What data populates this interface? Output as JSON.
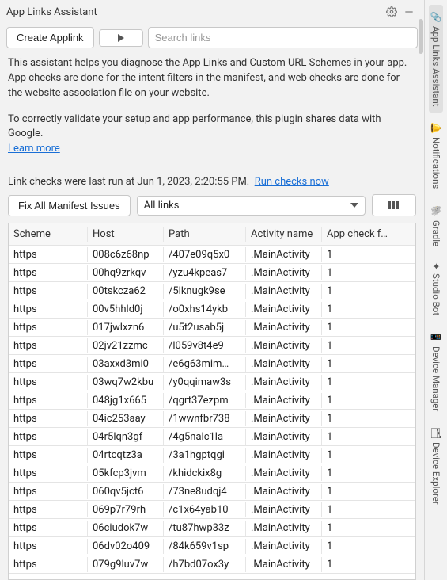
{
  "window": {
    "title": "App Links Assistant"
  },
  "toolbar": {
    "create_label": "Create Applink",
    "search_placeholder": "Search links"
  },
  "description": {
    "p1": "This assistant helps you diagnose the App Links and Custom URL Schemes in your app. App checks are done for the intent filters in the manifest, and web checks are done for the website association file on your website.",
    "p2": "To correctly validate your setup and app performance, this plugin shares data with Google.",
    "learn_more": "Learn more"
  },
  "status": {
    "text": "Link checks were last run at Jun 1, 2023, 2:20:55 PM.",
    "run_now": "Run checks now"
  },
  "controls": {
    "fix_label": "Fix All Manifest Issues",
    "filter_label": "All links"
  },
  "table": {
    "headers": [
      "Scheme",
      "Host",
      "Path",
      "Activity name",
      "App check f…"
    ],
    "rows": [
      {
        "scheme": "https",
        "host": "008c6z68np",
        "path": "/407e09q5x0",
        "activity": ".MainActivity",
        "check": "1"
      },
      {
        "scheme": "https",
        "host": "00hq9zrkqv",
        "path": "/yzu4kpeas7",
        "activity": ".MainActivity",
        "check": "1"
      },
      {
        "scheme": "https",
        "host": "00tskcza62",
        "path": "/5lknugk9se",
        "activity": ".MainActivity",
        "check": "1"
      },
      {
        "scheme": "https",
        "host": "00v5hhld0j",
        "path": "/o0xhs14ykb",
        "activity": ".MainActivity",
        "check": "1"
      },
      {
        "scheme": "https",
        "host": "017jwlxzn6",
        "path": "/u5t2usab5j",
        "activity": ".MainActivity",
        "check": "1"
      },
      {
        "scheme": "https",
        "host": "02jv21zzmc",
        "path": "/l059v8t4e9",
        "activity": ".MainActivity",
        "check": "1"
      },
      {
        "scheme": "https",
        "host": "03axxd3mi0",
        "path": "/e6g63mim…",
        "activity": ".MainActivity",
        "check": "1"
      },
      {
        "scheme": "https",
        "host": "03wq7w2kbu",
        "path": "/y0qqimaw3s",
        "activity": ".MainActivity",
        "check": "1"
      },
      {
        "scheme": "https",
        "host": "048jg1x665",
        "path": "/qgrt37ezpm",
        "activity": ".MainActivity",
        "check": "1"
      },
      {
        "scheme": "https",
        "host": "04ic253aay",
        "path": "/1wwnfbr738",
        "activity": ".MainActivity",
        "check": "1"
      },
      {
        "scheme": "https",
        "host": "04r5lqn3gf",
        "path": "/4g5nalc1la",
        "activity": ".MainActivity",
        "check": "1"
      },
      {
        "scheme": "https",
        "host": "04rtcqtz3a",
        "path": "/3a1hgptqgi",
        "activity": ".MainActivity",
        "check": "1"
      },
      {
        "scheme": "https",
        "host": "05kfcp3jvm",
        "path": "/khidckix8g",
        "activity": ".MainActivity",
        "check": "1"
      },
      {
        "scheme": "https",
        "host": "060qv5jct6",
        "path": "/73ne8udqj4",
        "activity": ".MainActivity",
        "check": "1"
      },
      {
        "scheme": "https",
        "host": "069p7r79rh",
        "path": "/c1x64yab10",
        "activity": ".MainActivity",
        "check": "1"
      },
      {
        "scheme": "https",
        "host": "06ciudok7w",
        "path": "/tu87hwp33z",
        "activity": ".MainActivity",
        "check": "1"
      },
      {
        "scheme": "https",
        "host": "06dv02o409",
        "path": "/84k659v1sp",
        "activity": ".MainActivity",
        "check": "1"
      },
      {
        "scheme": "https",
        "host": "079g9luv7w",
        "path": "/h7bd07ox3y",
        "activity": ".MainActivity",
        "check": "1"
      }
    ]
  },
  "rail": {
    "tabs": [
      "App Links Assistant",
      "Notifications",
      "Gradle",
      "Studio Bot",
      "Device Manager",
      "Device Explorer"
    ]
  }
}
